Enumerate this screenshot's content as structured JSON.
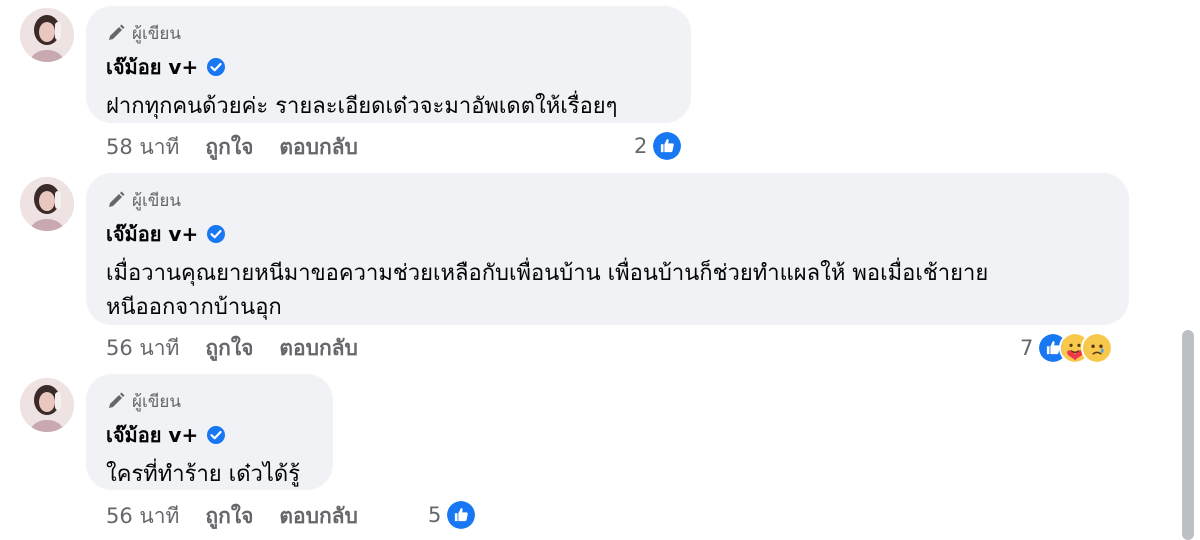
{
  "comments": [
    {
      "author_badge": "ผู้เขียน",
      "name": "เจ๊ม้อย v+",
      "text": "ฝากทุกคนด้วยค่ะ รายละเอียดเด๋วจะมาอัพเดตให้เรื่อยๆ",
      "time": "58 นาที",
      "like_label": "ถูกใจ",
      "reply_label": "ตอบกลับ",
      "reaction_count": "2",
      "reaction_icons": [
        "like-icon"
      ]
    },
    {
      "author_badge": "ผู้เขียน",
      "name": "เจ๊ม้อย v+",
      "text": "เมื่อวานคุณยายหนีมาขอความช่วยเหลือกับเพื่อนบ้าน เพื่อนบ้านก็ช่วยทำแผลให้ พอเมื่อเช้ายาย\nหนีออกจากบ้านอุก",
      "time": "56 นาที",
      "like_label": "ถูกใจ",
      "reply_label": "ตอบกลับ",
      "reaction_count": "7",
      "reaction_icons": [
        "like-icon",
        "care-icon",
        "sad-icon"
      ]
    },
    {
      "author_badge": "ผู้เขียน",
      "name": "เจ๊ม้อย v+",
      "text": "ใครที่ทำร้าย เด๋วได้รู้",
      "time": "56 นาที",
      "like_label": "ถูกใจ",
      "reply_label": "ตอบกลับ",
      "reaction_count": "5",
      "reaction_icons": [
        "like-icon"
      ]
    }
  ],
  "colors": {
    "bubble": "#f0f2f5",
    "like_blue": "#1877f2",
    "meta_gray": "#65676b"
  }
}
